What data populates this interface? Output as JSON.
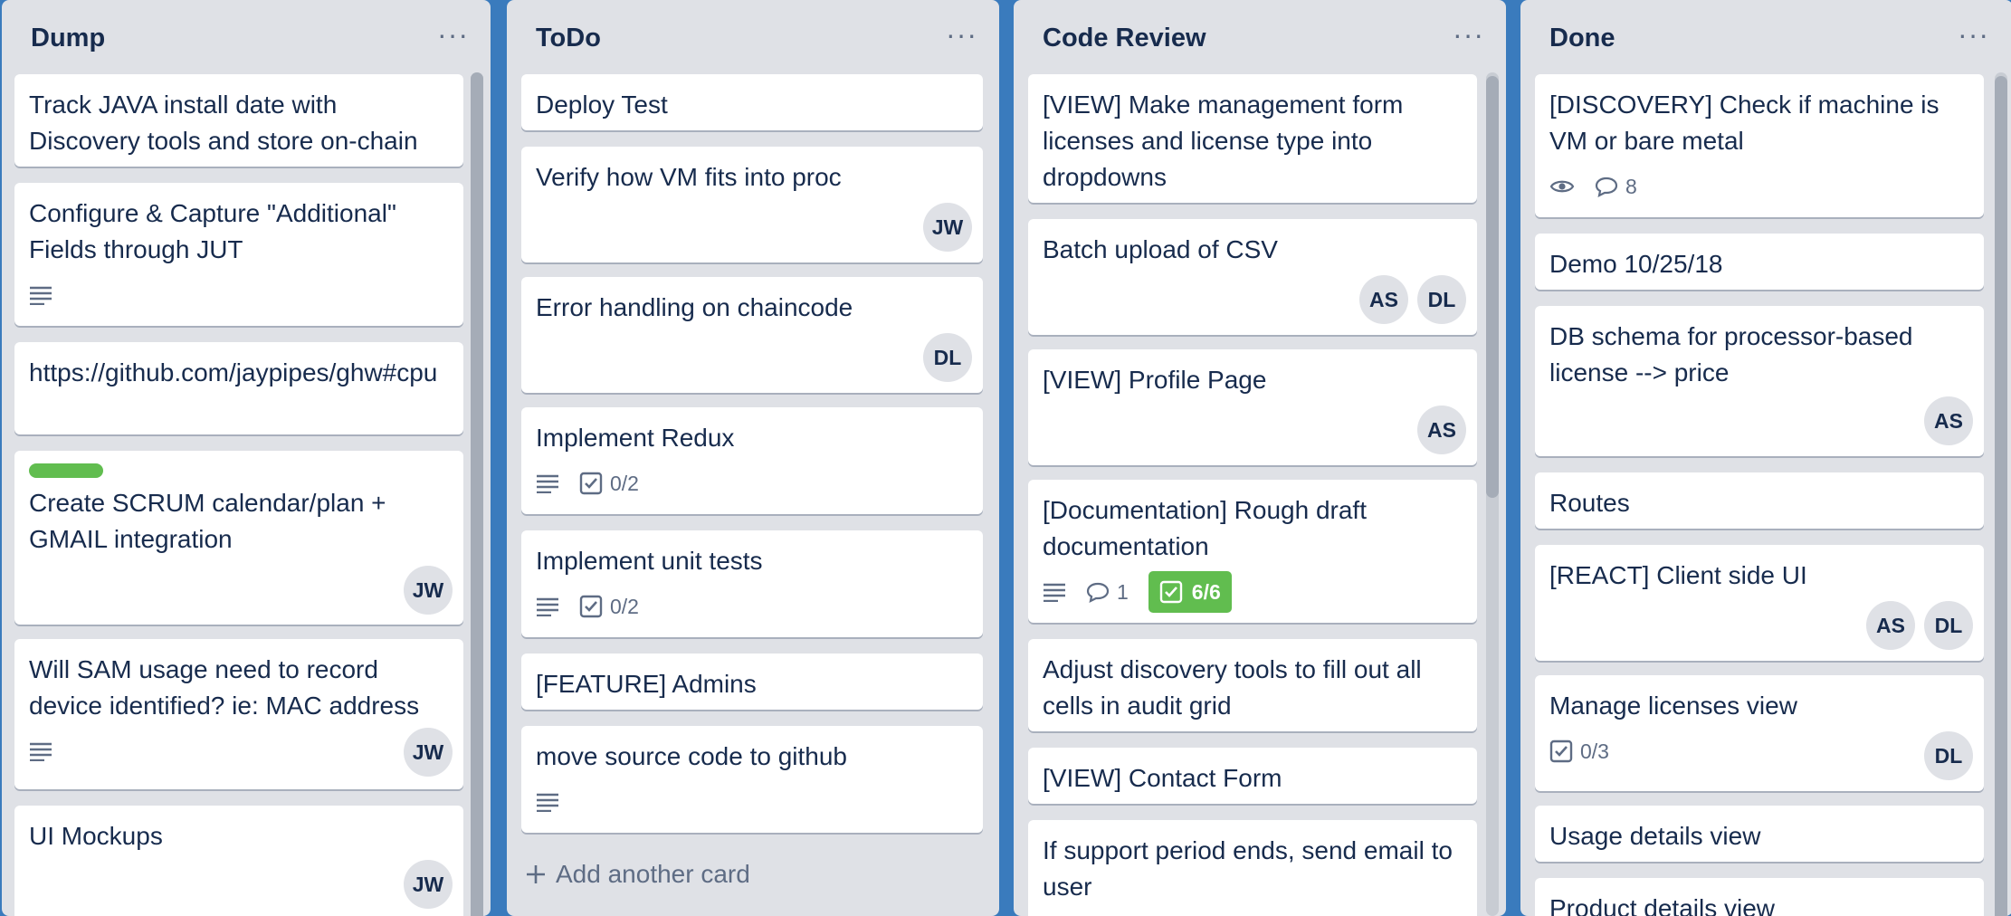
{
  "lists": [
    {
      "title": "Dump",
      "cards": [
        {
          "title": "Track JAVA install date with Discovery tools and store on-chain"
        },
        {
          "title": "Configure & Capture \"Additional\" Fields through JUT"
        },
        {
          "title": "https://github.com/jaypipes/ghw#cpu"
        },
        {
          "title": "Create SCRUM calendar/plan + GMAIL integration",
          "member": "JW"
        },
        {
          "title": "Will SAM usage need to record device identified? ie: MAC address",
          "member": "JW"
        },
        {
          "title": "UI Mockups",
          "member": "JW"
        }
      ]
    },
    {
      "title": "ToDo",
      "cards": [
        {
          "title": "Deploy Test"
        },
        {
          "title": "Verify how VM fits into proc",
          "member": "JW"
        },
        {
          "title": "Error handling on chaincode",
          "member": "DL"
        },
        {
          "title": "Implement Redux",
          "checklist": "0/2"
        },
        {
          "title": "Implement unit tests",
          "checklist": "0/2"
        },
        {
          "title": "[FEATURE] Admins"
        },
        {
          "title": "move source code to github"
        }
      ],
      "add_card_label": "Add another card"
    },
    {
      "title": "Code Review",
      "cards": [
        {
          "title": "[VIEW] Make management form licenses and license type into dropdowns"
        },
        {
          "title": "Batch upload of CSV",
          "members": [
            "AS",
            "DL"
          ]
        },
        {
          "title": "[VIEW] Profile Page",
          "member": "AS"
        },
        {
          "title": "[Documentation] Rough draft documentation",
          "comments": "1",
          "checklist": "6/6"
        },
        {
          "title": "Adjust discovery tools to fill out all cells in audit grid"
        },
        {
          "title": "[VIEW] Contact Form"
        },
        {
          "title": "If support period ends, send email to user"
        }
      ]
    },
    {
      "title": "Done",
      "cards": [
        {
          "title": "[DISCOVERY] Check if machine is VM or bare metal",
          "comments": "8"
        },
        {
          "title": "Demo 10/25/18"
        },
        {
          "title": "DB schema for processor-based license --> price",
          "member": "AS"
        },
        {
          "title": "Routes"
        },
        {
          "title": "[REACT] Client side UI",
          "members": [
            "AS",
            "DL"
          ]
        },
        {
          "title": "Manage licenses view",
          "checklist": "0/3",
          "member": "DL"
        },
        {
          "title": "Usage details view"
        },
        {
          "title": "Product details view"
        }
      ]
    }
  ],
  "menu_glyph": "···",
  "colors": {
    "board": "#3a7bbd",
    "list": "#dfe1e6",
    "card": "#ffffff",
    "label_green": "#61bd4f",
    "text": "#172b4d",
    "muted": "#5e6c84"
  }
}
